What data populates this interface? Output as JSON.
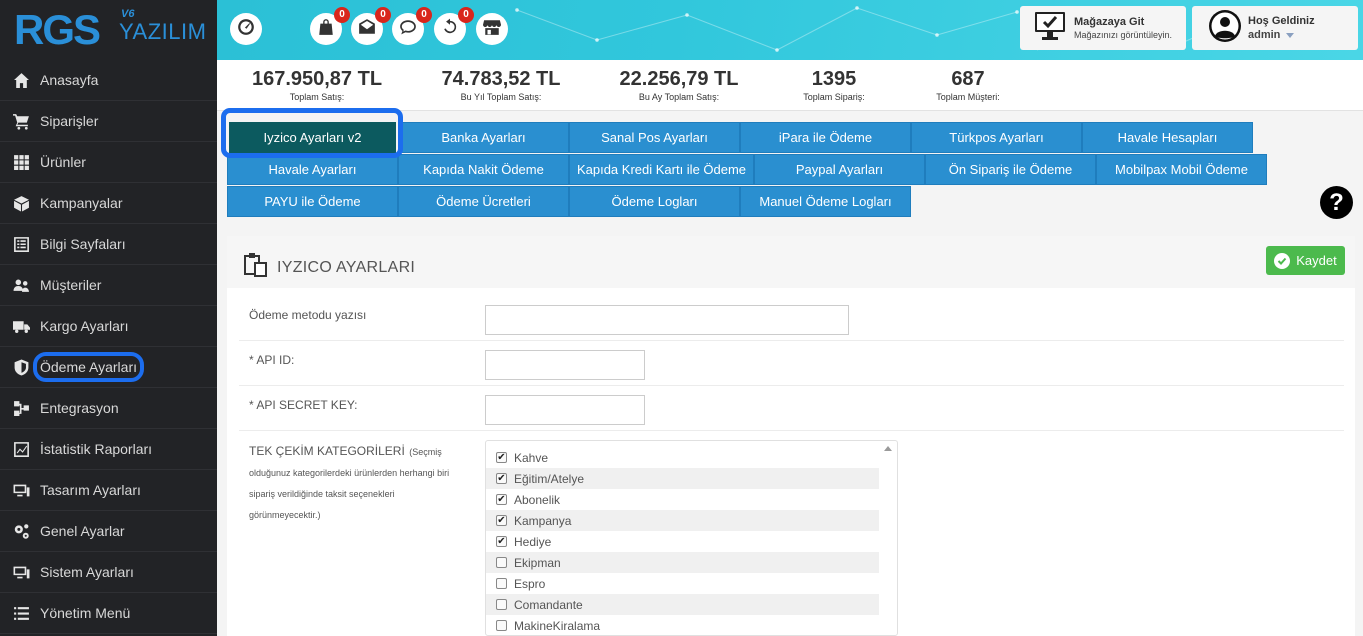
{
  "logo": {
    "brand": "RGS",
    "version": "V6",
    "suffix": "YAZILIM"
  },
  "sidebar": {
    "items": [
      {
        "label": "Anasayfa",
        "icon": "home-icon"
      },
      {
        "label": "Siparişler",
        "icon": "cart-icon"
      },
      {
        "label": "Ürünler",
        "icon": "grid-icon"
      },
      {
        "label": "Kampanyalar",
        "icon": "box-icon"
      },
      {
        "label": "Bilgi Sayfaları",
        "icon": "list-icon"
      },
      {
        "label": "Müşteriler",
        "icon": "users-icon"
      },
      {
        "label": "Kargo Ayarları",
        "icon": "truck-icon"
      },
      {
        "label": "Ödeme Ayarları",
        "icon": "shield-icon"
      },
      {
        "label": "Entegrasyon",
        "icon": "network-icon"
      },
      {
        "label": "İstatistik Raporları",
        "icon": "chart-icon"
      },
      {
        "label": "Tasarım Ayarları",
        "icon": "monitor-icon"
      },
      {
        "label": "Genel Ayarlar",
        "icon": "gears-icon"
      },
      {
        "label": "Sistem Ayarları",
        "icon": "monitor-icon"
      },
      {
        "label": "Yönetim Menü",
        "icon": "menu-icon"
      }
    ]
  },
  "header": {
    "badges": [
      "0",
      "0",
      "0",
      "0"
    ],
    "store": {
      "title": "Mağazaya Git",
      "subtitle": "Mağazınızı görüntüleyin."
    },
    "user": {
      "greeting": "Hoş Geldiniz",
      "name": "admin"
    }
  },
  "stats": [
    {
      "value": "167.950,87 TL",
      "label": "Toplam Satış:"
    },
    {
      "value": "74.783,52 TL",
      "label": "Bu Yıl Toplam Satış:"
    },
    {
      "value": "22.256,79 TL",
      "label": "Bu Ay Toplam Satış:"
    },
    {
      "value": "1395",
      "label": "Toplam Sipariş:"
    },
    {
      "value": "687",
      "label": "Toplam Müşteri:"
    }
  ],
  "tabs": [
    "Iyzico Ayarları v2",
    "Banka Ayarları",
    "Sanal Pos Ayarları",
    "iPara ile Ödeme",
    "Türkpos Ayarları",
    "Havale Hesapları",
    "Havale Ayarları",
    "Kapıda Nakit Ödeme",
    "Kapıda Kredi Kartı ile Ödeme",
    "Paypal Ayarları",
    "Ön Sipariş ile Ödeme",
    "Mobilpax Mobil Ödeme",
    "PAYU ile Ödeme",
    "Ödeme Ücretleri",
    "Ödeme Logları",
    "Manuel Ödeme Logları"
  ],
  "help": "?",
  "panel": {
    "title": "IYZICO AYARLARI",
    "save_label": "Kaydet",
    "fields": {
      "method_label": "Ödeme metodu yazısı",
      "method_value": "",
      "api_id_label": "* API ID:",
      "api_id_value": "",
      "api_secret_label": "* API SECRET KEY:",
      "api_secret_value": ""
    },
    "categories_label": "TEK ÇEKİM KATEGORİLERİ",
    "categories_desc": "(Seçmiş olduğunuz kategorilerdeki ürünlerden herhangi biri sipariş verildiğinde taksit seçenekleri görünmeyecektir.)",
    "categories": [
      {
        "name": "Kahve",
        "checked": true
      },
      {
        "name": "Eğitim/Atelye",
        "checked": true
      },
      {
        "name": "Abonelik",
        "checked": true
      },
      {
        "name": "Kampanya",
        "checked": true
      },
      {
        "name": "Hediye",
        "checked": true
      },
      {
        "name": "Ekipman",
        "checked": false
      },
      {
        "name": "Espro",
        "checked": false
      },
      {
        "name": "Comandante",
        "checked": false
      },
      {
        "name": "MakineKiralama",
        "checked": false
      }
    ]
  },
  "colors": {
    "sidebar_bg": "#222326",
    "accent": "#2a8fd0",
    "active_tab": "#0c5a5f",
    "highlight": "#1c6dee",
    "save": "#4cba4d"
  }
}
